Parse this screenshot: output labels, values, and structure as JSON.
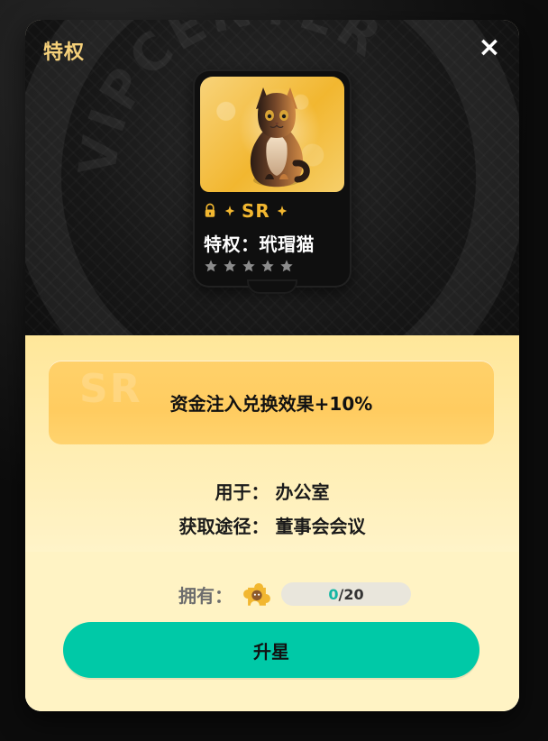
{
  "modal": {
    "title": "特权",
    "close_label": "×"
  },
  "card": {
    "rarity": "SR",
    "name": "特权：玳瑁猫",
    "stars_total": 5,
    "stars_filled": 0,
    "icons": {
      "lock": "lock-icon",
      "spark": "spark-icon",
      "star": "star-icon",
      "cat": "cat-illustration"
    },
    "background_watermark": "VIPCENTER"
  },
  "effect": {
    "text": "资金注入兑换效果+10%",
    "watermark": "SR"
  },
  "details": {
    "use_for_label": "用于：",
    "use_for_value": "办公室",
    "source_label": "获取途径：",
    "source_value": "董事会会议"
  },
  "ownership": {
    "label": "拥有：",
    "current": "0",
    "max": "20",
    "separator": "/"
  },
  "actions": {
    "upgrade_label": "升星"
  },
  "colors": {
    "accent": "#00c9a7",
    "gold": "#f2b730",
    "panel": "#fff3c4"
  }
}
